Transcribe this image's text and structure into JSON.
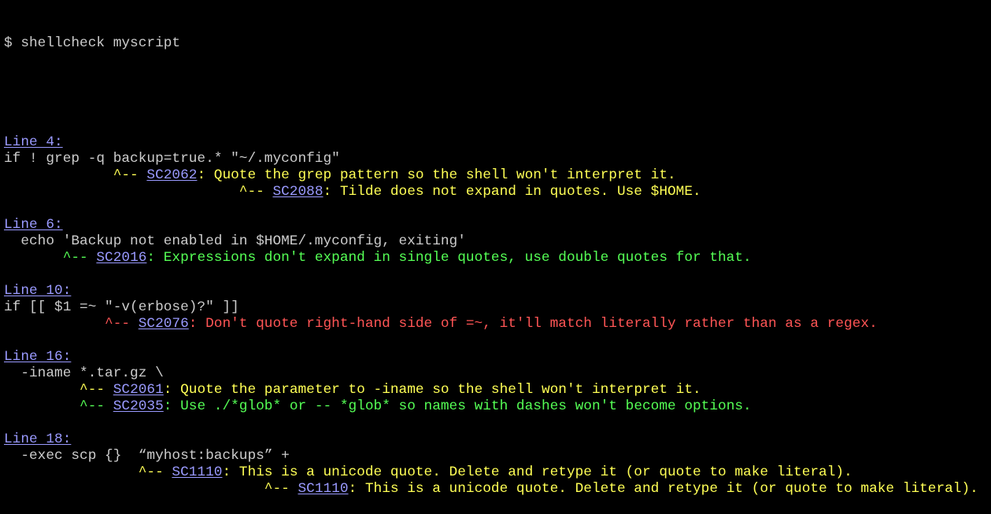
{
  "prompt_line": "$ shellcheck myscript",
  "blocks": [
    {
      "header": "Line 4:",
      "code": "if ! grep -q backup=true.* \"~/.myconfig\"",
      "warnings": [
        {
          "indent": "             ",
          "caret": "^--",
          "code": "SC2062",
          "message": ": Quote the grep pattern so the shell won't interpret it.",
          "color": "#ffff55"
        },
        {
          "indent": "                            ",
          "caret": "^--",
          "code": "SC2088",
          "message": ": Tilde does not expand in quotes. Use $HOME.",
          "color": "#ffff55"
        }
      ]
    },
    {
      "header": "Line 6:",
      "code": "  echo 'Backup not enabled in $HOME/.myconfig, exiting'",
      "warnings": [
        {
          "indent": "       ",
          "caret": "^--",
          "code": "SC2016",
          "message": ": Expressions don't expand in single quotes, use double quotes for that.",
          "color": "#55ff55"
        }
      ]
    },
    {
      "header": "Line 10:",
      "code": "if [[ $1 =~ \"-v(erbose)?\" ]]",
      "warnings": [
        {
          "indent": "            ",
          "caret": "^--",
          "code": "SC2076",
          "message": ": Don't quote right-hand side of =~, it'll match literally rather than as a regex.",
          "color": "#ff5555"
        }
      ]
    },
    {
      "header": "Line 16:",
      "code": "  -iname *.tar.gz \\",
      "warnings": [
        {
          "indent": "         ",
          "caret": "^--",
          "code": "SC2061",
          "message": ": Quote the parameter to -iname so the shell won't interpret it.",
          "color": "#ffff55"
        },
        {
          "indent": "         ",
          "caret": "^--",
          "code": "SC2035",
          "message": ": Use ./*glob* or -- *glob* so names with dashes won't become options.",
          "color": "#55ff55"
        }
      ]
    },
    {
      "header": "Line 18:",
      "code": "  -exec scp {}  “myhost:backups” +",
      "warnings": [
        {
          "indent": "                ",
          "caret": "^--",
          "code": "SC1110",
          "message": ": This is a unicode quote. Delete and retype it (or quote to make literal).",
          "color": "#ffff55"
        },
        {
          "indent": "                               ",
          "caret": "^--",
          "code": "SC1110",
          "message": ": This is a unicode quote. Delete and retype it (or quote to make literal).",
          "color": "#ffff55"
        }
      ]
    }
  ],
  "colors": {
    "background": "#000000",
    "text": "#cccccc",
    "link": "#9a9aff",
    "warning": "#ffff55",
    "info": "#55ff55",
    "error": "#ff5555"
  }
}
